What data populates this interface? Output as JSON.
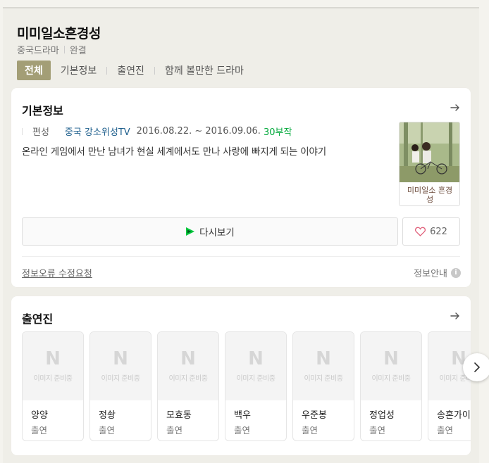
{
  "header": {
    "title": "미미일소흔경성",
    "genre": "중국드라마",
    "status": "완결"
  },
  "tabs": [
    {
      "label": "전체",
      "active": true
    },
    {
      "label": "기본정보",
      "active": false
    },
    {
      "label": "출연진",
      "active": false
    },
    {
      "label": "함께 볼만한 드라마",
      "active": false
    }
  ],
  "basic_info": {
    "title": "기본정보",
    "label": "편성",
    "channel": "중국 강소위성TV",
    "dates": "2016.08.22. ~ 2016.09.06.",
    "episodes": "30부작",
    "synopsis": "온라인 게임에서 만난 남녀가 현실 세계에서도 만나 사랑에 빠지게 되는 이야기",
    "poster_text": "미미일소 흔경성",
    "watch_label": "다시보기",
    "like_count": "622",
    "report_label": "정보오류 수정요청",
    "guide_label": "정보안내"
  },
  "cast_section": {
    "title": "출연진",
    "placeholder_letter": "N",
    "placeholder_text": "이미지 준비중",
    "members": [
      {
        "name": "양양",
        "role": "출연"
      },
      {
        "name": "정솽",
        "role": "출연"
      },
      {
        "name": "모효동",
        "role": "출연"
      },
      {
        "name": "백우",
        "role": "출연"
      },
      {
        "name": "우준봉",
        "role": "출연"
      },
      {
        "name": "정업성",
        "role": "출연"
      },
      {
        "name": "송혼가이",
        "role": "출연"
      }
    ]
  },
  "colors": {
    "active_tab": "#a39e76",
    "channel": "#1d5e8c",
    "episodes": "#00a83a",
    "play_icon": "#00c73c",
    "heart": "#e0607a"
  },
  "icons": {
    "arrow": "arrow-right-icon",
    "play": "play-icon",
    "heart": "heart-icon",
    "info": "info-icon",
    "next": "chevron-right-icon"
  }
}
